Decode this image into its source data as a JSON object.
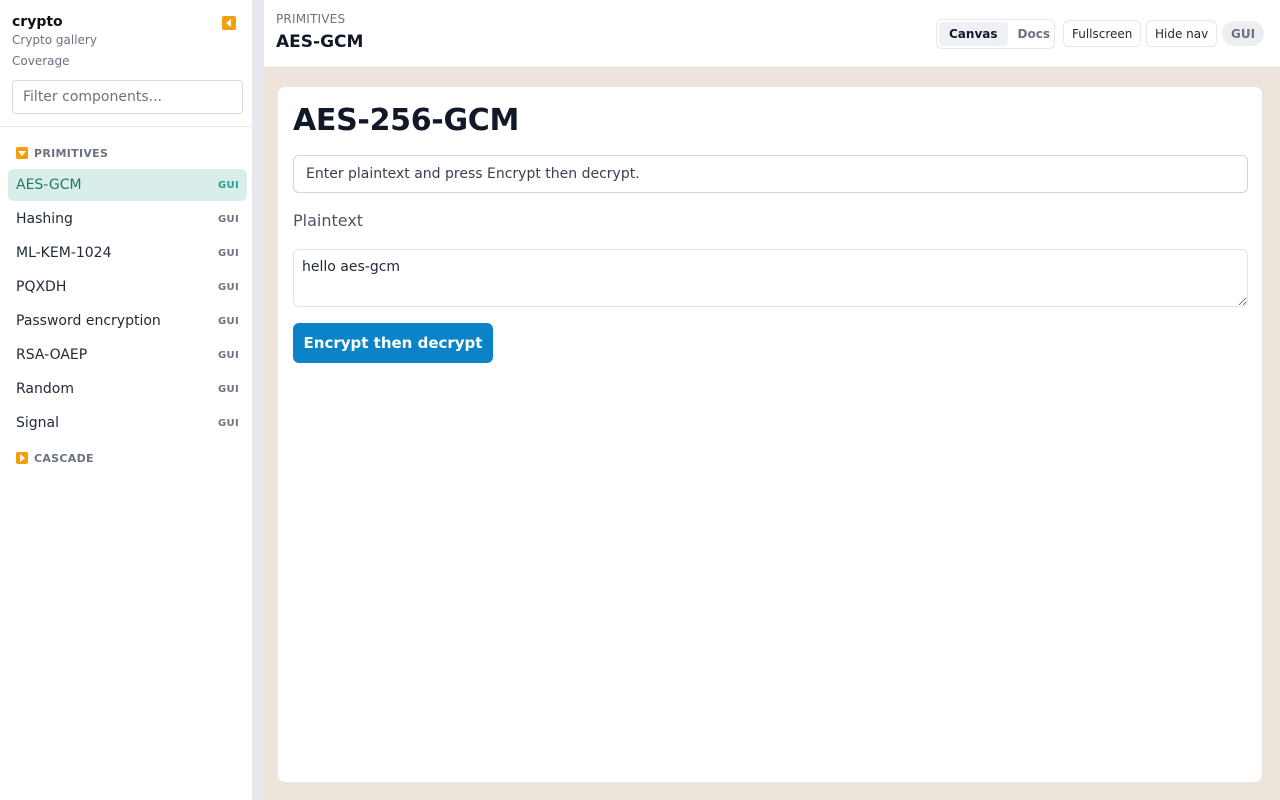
{
  "sidebar": {
    "title": "crypto",
    "subtitle": "Crypto gallery",
    "coverage_link": "Coverage",
    "filter_placeholder": "Filter components...",
    "groups": [
      {
        "label": "PRIMITIVES",
        "expanded": true,
        "items": [
          {
            "label": "AES-GCM",
            "tag": "GUI",
            "active": true
          },
          {
            "label": "Hashing",
            "tag": "GUI"
          },
          {
            "label": "ML-KEM-1024",
            "tag": "GUI"
          },
          {
            "label": "PQXDH",
            "tag": "GUI"
          },
          {
            "label": "Password encryption",
            "tag": "GUI"
          },
          {
            "label": "RSA-OAEP",
            "tag": "GUI"
          },
          {
            "label": "Random",
            "tag": "GUI"
          },
          {
            "label": "Signal",
            "tag": "GUI"
          }
        ]
      },
      {
        "label": "CASCADE",
        "expanded": false,
        "items": []
      }
    ]
  },
  "header": {
    "breadcrumb": "PRIMITIVES",
    "title": "AES-GCM",
    "view_tabs": [
      {
        "label": "Canvas",
        "active": true
      },
      {
        "label": "Docs",
        "active": false
      }
    ],
    "fullscreen_label": "Fullscreen",
    "hide_nav_label": "Hide nav",
    "mode_badge": "GUI"
  },
  "main": {
    "heading": "AES-256-GCM",
    "status_text": "Enter plaintext and press Encrypt then decrypt.",
    "plaintext_label": "Plaintext",
    "plaintext_value": "hello aes-gcm",
    "action_label": "Encrypt then decrypt"
  },
  "colors": {
    "accent_orange": "#f59e0b",
    "active_item_bg": "#d9eeea",
    "primary_button": "#0a84c6",
    "canvas_bg": "#ede4dc"
  }
}
